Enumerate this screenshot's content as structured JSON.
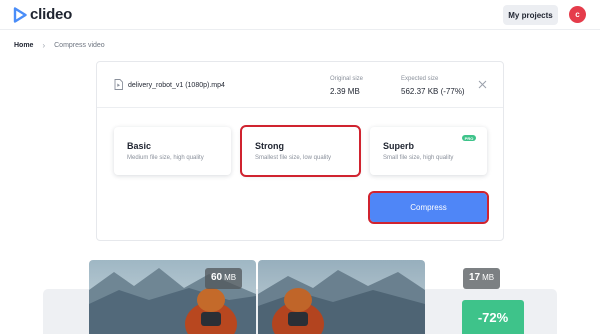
{
  "brand": {
    "name": "clideo",
    "color": "#4a8df8"
  },
  "header": {
    "projects_label": "My projects",
    "avatar_initial": "c"
  },
  "breadcrumb": {
    "home": "Home",
    "separator": "›",
    "current": "Compress video"
  },
  "file": {
    "name": "delivery_robot_v1 (1080p).mp4",
    "original_label": "Original size",
    "original_value": "2.39 MB",
    "expected_label": "Expected size",
    "expected_value": "562.37 KB (-77%)"
  },
  "options": [
    {
      "title": "Basic",
      "desc": "Medium file size, high quality",
      "selected": false
    },
    {
      "title": "Strong",
      "desc": "Smallest file size, low quality",
      "selected": true
    },
    {
      "title": "Superb",
      "desc": "Small file size, high quality",
      "badge": "PRO",
      "selected": false
    }
  ],
  "compress_label": "Compress",
  "comparison": {
    "before": {
      "num": "60",
      "unit": "MB"
    },
    "after": {
      "num": "17",
      "unit": "MB"
    },
    "reduction": "-72%"
  },
  "colors": {
    "accent": "#4f86f7",
    "success": "#3ec38a",
    "highlight": "#d0232f",
    "avatar": "#e53c4b"
  }
}
